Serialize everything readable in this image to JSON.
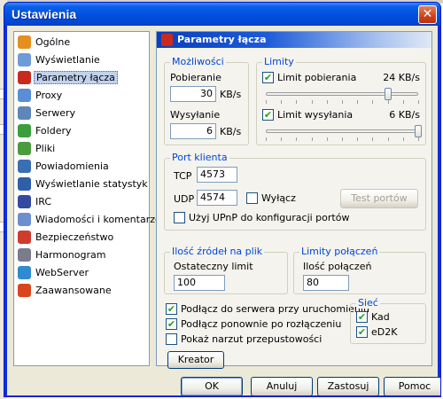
{
  "window": {
    "title": "Ustawienia",
    "close_glyph": "✕"
  },
  "sidebar": {
    "items": [
      {
        "label": "Ogólne",
        "icon": "gear-icon",
        "color": "#e58f1f"
      },
      {
        "label": "Wyświetlanie",
        "icon": "display-icon",
        "color": "#6f9bd6"
      },
      {
        "label": "Parametry łącza",
        "icon": "connection-icon",
        "color": "#c92a1d"
      },
      {
        "label": "Proxy",
        "icon": "proxy-icon",
        "color": "#5a8ed6"
      },
      {
        "label": "Serwery",
        "icon": "server-icon",
        "color": "#5f86b8"
      },
      {
        "label": "Foldery",
        "icon": "folder-icon",
        "color": "#3b9e3b"
      },
      {
        "label": "Pliki",
        "icon": "file-icon",
        "color": "#4a9c3e"
      },
      {
        "label": "Powiadomienia",
        "icon": "notification-icon",
        "color": "#3a6fb5"
      },
      {
        "label": "Wyświetlanie statystyk",
        "icon": "statistics-icon",
        "color": "#2f5fa8"
      },
      {
        "label": "IRC",
        "icon": "irc-icon",
        "color": "#334a9e"
      },
      {
        "label": "Wiadomości i komentarze",
        "icon": "messages-icon",
        "color": "#6b8ed1"
      },
      {
        "label": "Bezpieczeństwo",
        "icon": "security-icon",
        "color": "#cf3b2c"
      },
      {
        "label": "Harmonogram",
        "icon": "scheduler-icon",
        "color": "#7b7b8c"
      },
      {
        "label": "WebServer",
        "icon": "webserver-icon",
        "color": "#2e8bd0"
      },
      {
        "label": "Zaawansowane",
        "icon": "advanced-icon",
        "color": "#d9461e"
      }
    ]
  },
  "panel": {
    "title": "Parametry łącza",
    "capacities": {
      "title": "Możliwości",
      "download_label": "Pobieranie",
      "download_value": "30",
      "download_unit": "KB/s",
      "upload_label": "Wysyłanie",
      "upload_value": "6",
      "upload_unit": "KB/s"
    },
    "limits": {
      "title": "Limity",
      "download_limit_label": "Limit pobierania",
      "download_limit_value": "24 KB/s",
      "download_limit_checked": true,
      "download_slider_fraction": 0.8,
      "upload_limit_label": "Limit wysyłania",
      "upload_limit_value": "6 KB/s",
      "upload_limit_checked": true,
      "upload_slider_fraction": 1.0
    },
    "client_port": {
      "title": "Port klienta",
      "tcp_label": "TCP",
      "tcp_value": "4573",
      "udp_label": "UDP",
      "udp_value": "4574",
      "disable_label": "Wyłącz",
      "disable_checked": false,
      "test_button": "Test portów",
      "upnp_label": "Użyj UPnP do konfiguracji portów",
      "upnp_checked": false
    },
    "sources": {
      "title": "Ilość źródeł na plik",
      "limit_label": "Ostateczny limit",
      "limit_value": "100"
    },
    "connection_limits": {
      "title": "Limity połączeń",
      "count_label": "Ilość połączeń",
      "count_value": "80"
    },
    "options": {
      "connect_on_start": "Podłącz do serwera przy uruchomieniu",
      "connect_on_start_checked": true,
      "reconnect": "Podłącz ponownie po rozłączeniu",
      "reconnect_checked": true,
      "show_overhead": "Pokaż narzut przepustowości",
      "show_overhead_checked": false
    },
    "network": {
      "title": "Sieć",
      "kad_label": "Kad",
      "kad_checked": true,
      "ed2k_label": "eD2K",
      "ed2k_checked": true
    },
    "wizard_button": "Kreator"
  },
  "footer": {
    "ok": "OK",
    "cancel": "Anuluj",
    "apply": "Zastosuj",
    "help": "Pomoc"
  },
  "check_glyph": "✔"
}
